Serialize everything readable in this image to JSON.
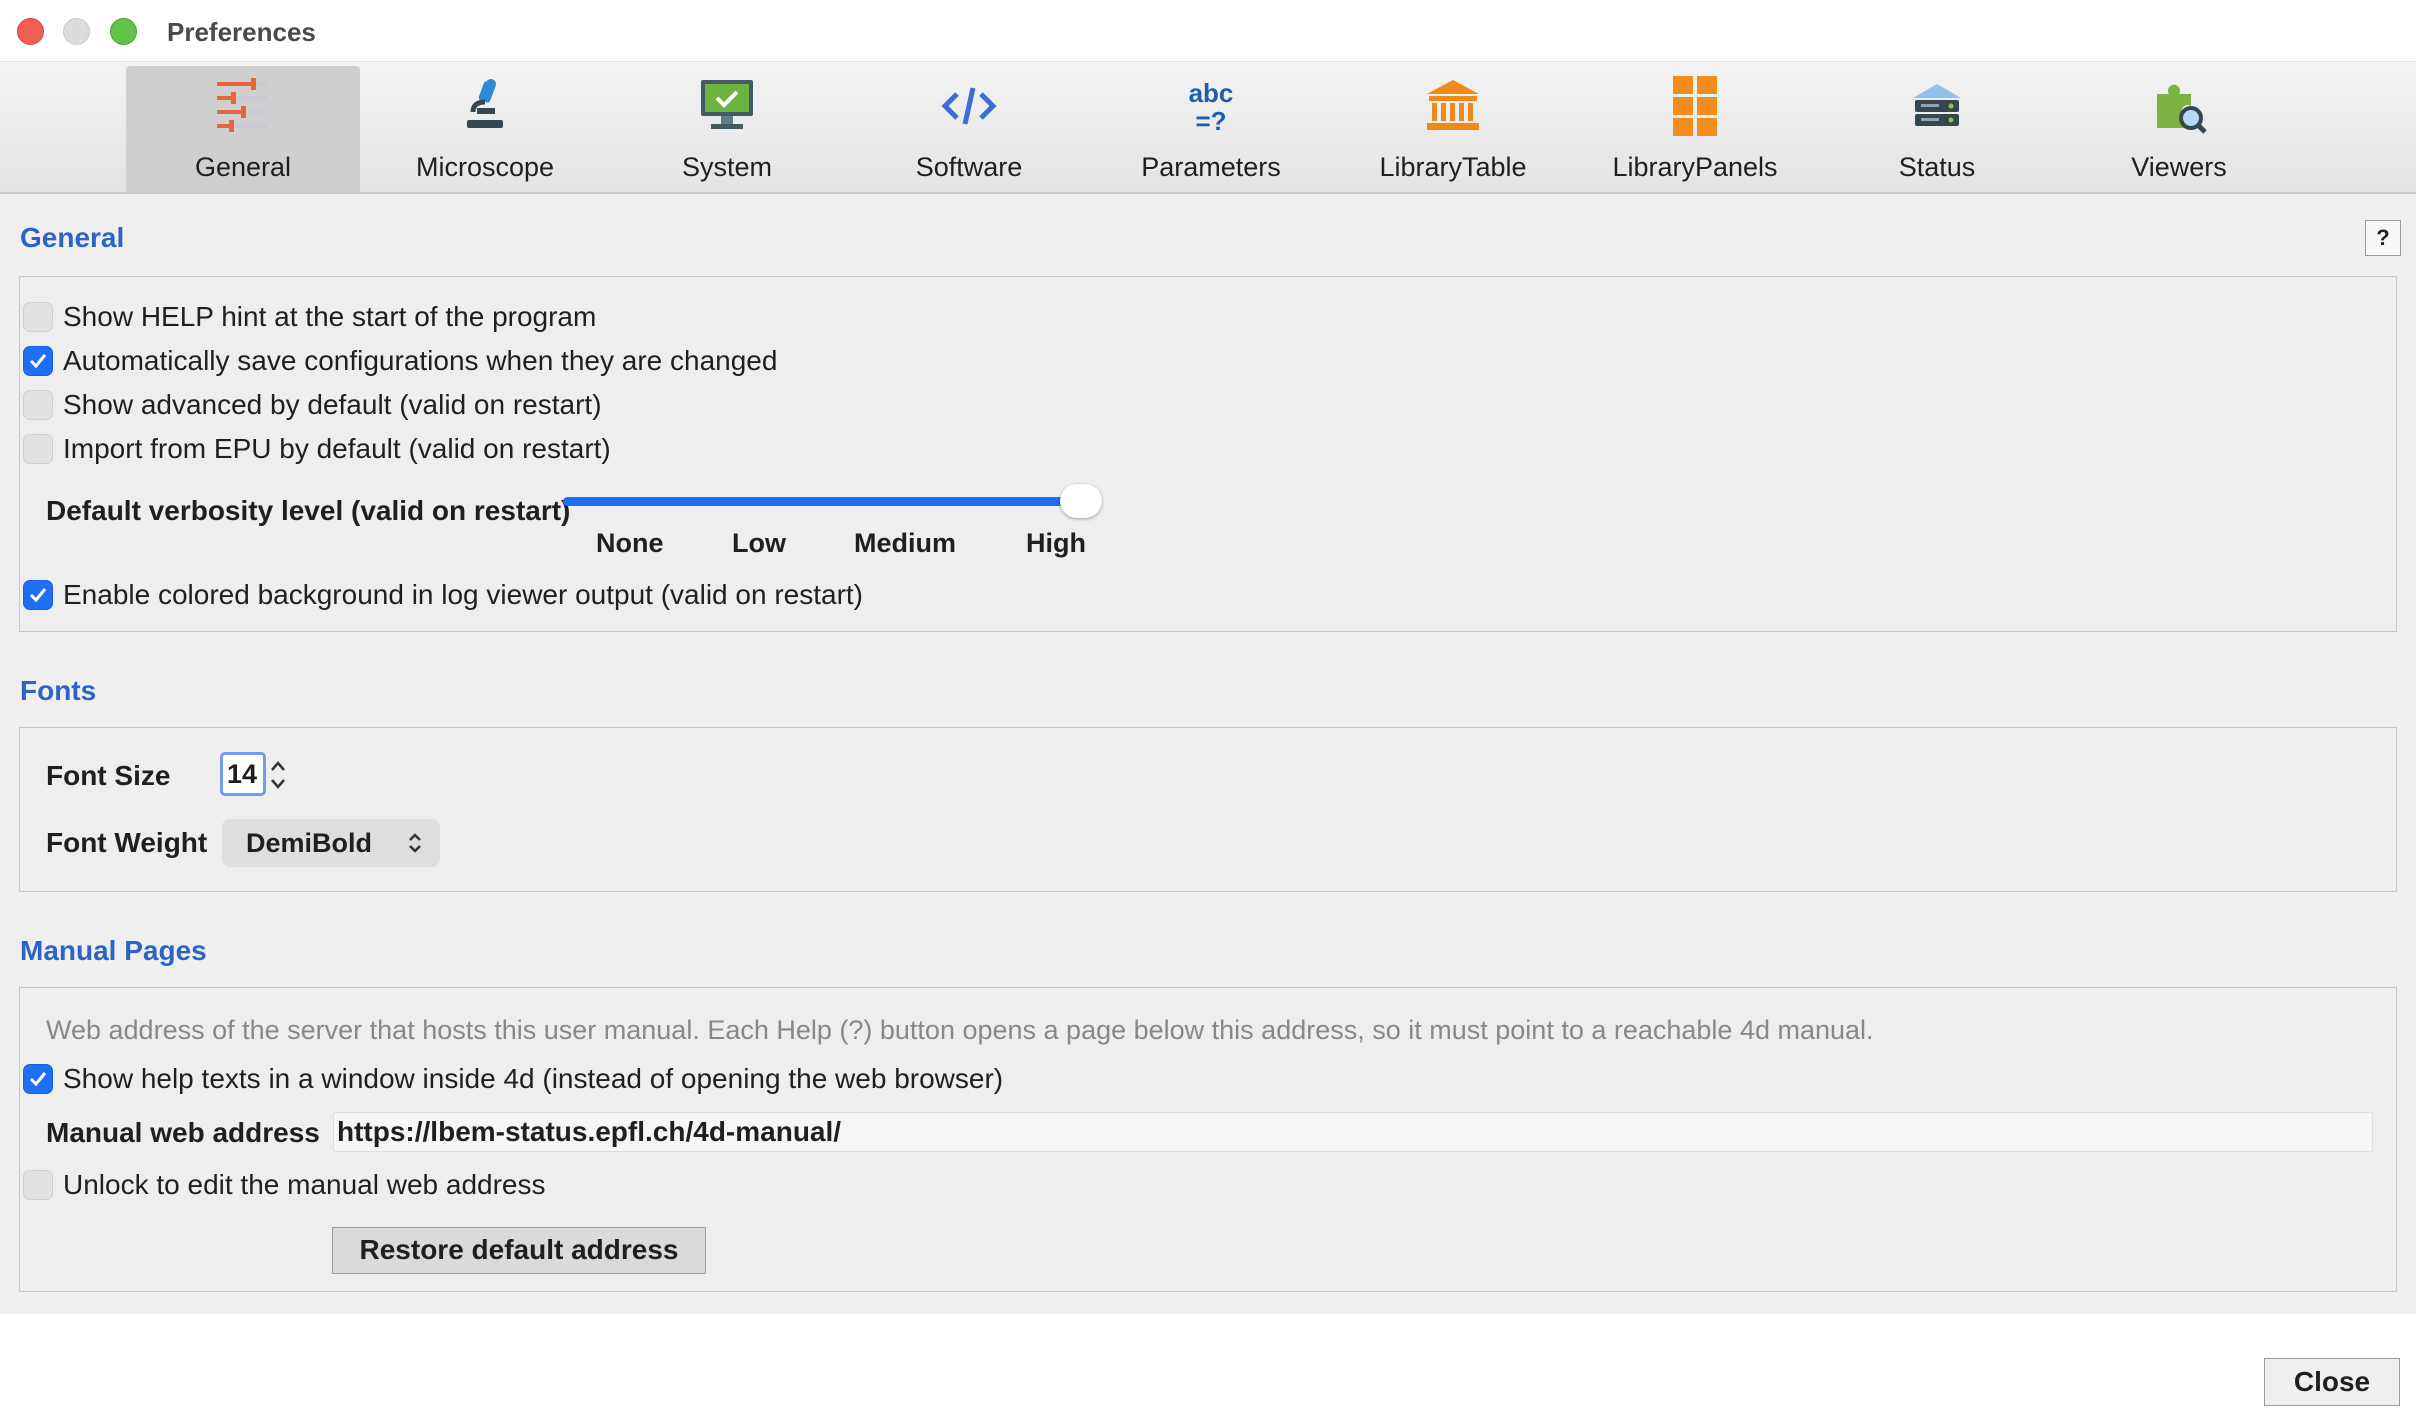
{
  "window": {
    "title": "Preferences"
  },
  "tabs": [
    {
      "label": "General",
      "icon": "sliders-icon",
      "active": true
    },
    {
      "label": "Microscope",
      "icon": "microscope-icon"
    },
    {
      "label": "System",
      "icon": "monitor-icon"
    },
    {
      "label": "Software",
      "icon": "code-icon"
    },
    {
      "label": "Parameters",
      "icon": "abc-icon",
      "icon_text_top": "abc",
      "icon_text_bottom": "=?"
    },
    {
      "label": "LibraryTable",
      "icon": "library-icon"
    },
    {
      "label": "LibraryPanels",
      "icon": "panels-icon"
    },
    {
      "label": "Status",
      "icon": "server-icon"
    },
    {
      "label": "Viewers",
      "icon": "puzzle-search-icon"
    }
  ],
  "general": {
    "title": "General",
    "help_label": "?",
    "options": [
      {
        "label": "Show HELP hint at the start of the program",
        "checked": false
      },
      {
        "label": "Automatically save configurations when they are changed",
        "checked": true
      },
      {
        "label": "Show advanced by default (valid on restart)",
        "checked": false
      },
      {
        "label": "Import from EPU by default (valid on restart)",
        "checked": false
      }
    ],
    "verbosity": {
      "label": "Default verbosity level (valid on restart)",
      "levels": [
        "None",
        "Low",
        "Medium",
        "High"
      ],
      "selected": "High"
    },
    "colored_bg": {
      "label": "Enable colored background in log viewer output (valid on restart)",
      "checked": true
    }
  },
  "fonts": {
    "title": "Fonts",
    "size_label": "Font Size",
    "size_value": "14",
    "weight_label": "Font Weight",
    "weight_value": "DemiBold"
  },
  "manual": {
    "title": "Manual Pages",
    "description": "Web address of the server that hosts this user manual. Each Help (?) button opens a page below this address, so it must point to a reachable 4d manual.",
    "show_in_window": {
      "label": "Show help texts in a window inside 4d (instead of opening the web browser)",
      "checked": true
    },
    "address_label": "Manual web address",
    "address_value": "https://lbem-status.epfl.ch/4d-manual/",
    "unlock": {
      "label": "Unlock to edit the manual web address",
      "checked": false
    },
    "restore_label": "Restore default address"
  },
  "footer": {
    "close_label": "Close"
  },
  "colors": {
    "accent": "#1f6ff2",
    "section_title": "#2d63c5"
  }
}
